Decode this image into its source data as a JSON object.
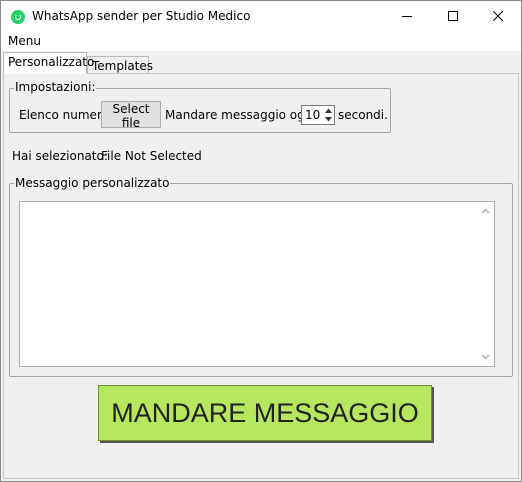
{
  "window": {
    "title": "WhatsApp sender per Studio Medico"
  },
  "menu": {
    "item": "Menu"
  },
  "tabs": [
    {
      "label": "Personalizzato",
      "active": true
    },
    {
      "label": "Templates",
      "active": false
    }
  ],
  "settings": {
    "group_label": "Impostazioni:",
    "numbers_label": "Elenco numeri:",
    "select_file_label": "Select file",
    "interval_label": "Mandare messaggio ogni",
    "interval_value": "10",
    "seconds_label": "secondi."
  },
  "selection": {
    "label": "Hai selezionato:",
    "value": "File Not Selected"
  },
  "message": {
    "group_label": "Messaggio personalizzato",
    "text": ""
  },
  "send_button": {
    "label": "MANDARE MESSAGGIO"
  },
  "colors": {
    "send_button_bg": "#b7e75f",
    "whatsapp_green": "#25d366"
  }
}
